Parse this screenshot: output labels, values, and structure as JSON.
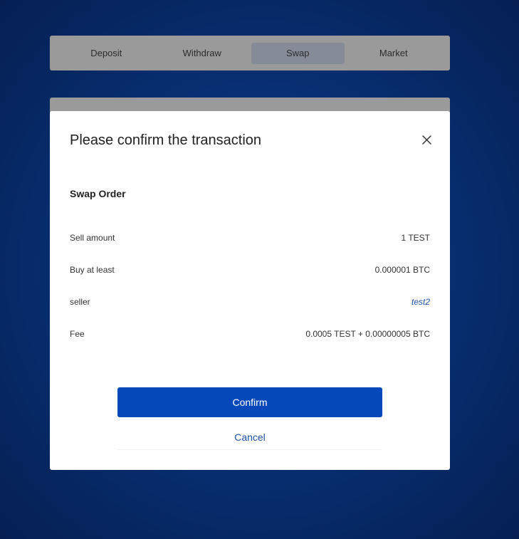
{
  "tabs": [
    {
      "label": "Deposit",
      "active": false
    },
    {
      "label": "Withdraw",
      "active": false
    },
    {
      "label": "Swap",
      "active": true
    },
    {
      "label": "Market",
      "active": false
    }
  ],
  "modal": {
    "title": "Please confirm the transaction",
    "close_icon": "close-icon",
    "section": "Swap Order",
    "rows": [
      {
        "label": "Sell amount",
        "value": "1 TEST"
      },
      {
        "label": "Buy at least",
        "value": "0.000001 BTC"
      },
      {
        "label": "seller",
        "value": "test2"
      },
      {
        "label": "Fee",
        "value": "0.0005 TEST + 0.00000005 BTC"
      }
    ],
    "confirm_label": "Confirm",
    "cancel_label": "Cancel"
  },
  "colors": {
    "primary": "#0448b9",
    "link": "#1d4fa6",
    "backdrop": "#083074"
  }
}
